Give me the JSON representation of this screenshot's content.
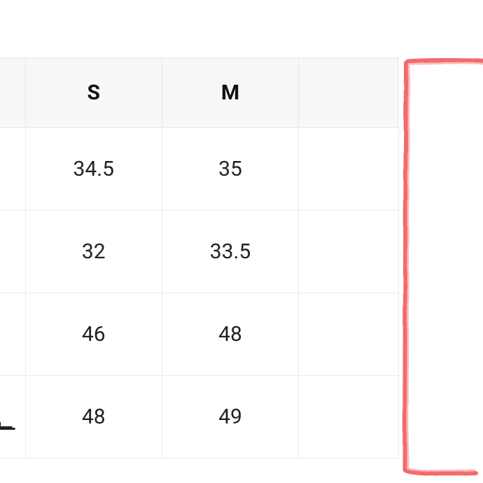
{
  "chart_data": {
    "type": "table",
    "columns": [
      "",
      "S",
      "M",
      ""
    ],
    "rows": [
      [
        "",
        "34.5",
        "35",
        ""
      ],
      [
        "",
        "32",
        "33.5",
        ""
      ],
      [
        "",
        "46",
        "48",
        ""
      ],
      [
        "ᅧᆫ",
        "48",
        "49",
        ""
      ]
    ]
  },
  "annotation": {
    "color": "#f36b6b"
  }
}
